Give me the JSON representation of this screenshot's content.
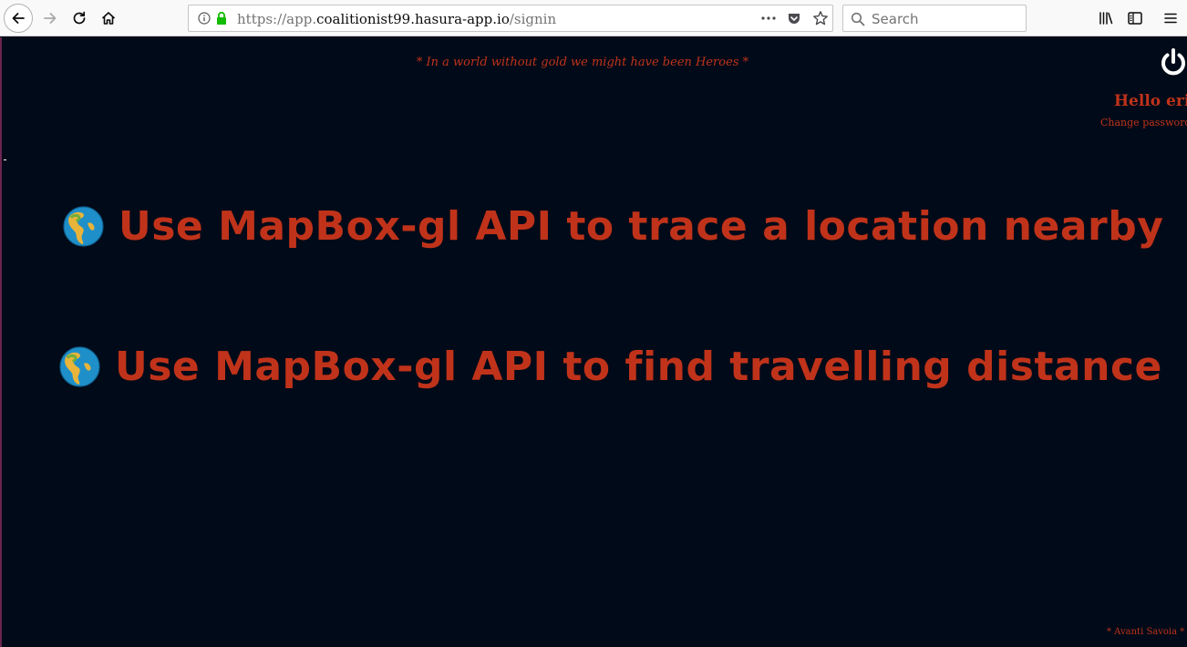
{
  "browser": {
    "url_scheme": "https://app.",
    "url_host": "coalitionist99.hasura-app.io",
    "url_path": "/signin",
    "search_placeholder": "Search",
    "icons": [
      "back-icon",
      "forward-icon",
      "reload-icon",
      "home-icon",
      "info-icon",
      "lock-icon",
      "more-icon",
      "pocket-icon",
      "star-icon",
      "search-icon",
      "library-icon",
      "sidebar-icon",
      "menu-icon"
    ]
  },
  "header": {
    "tagline": "* In a world without gold we might have been Heroes *",
    "greeting": "Hello erik",
    "change_password": "Change password?"
  },
  "features": [
    {
      "icon": "globe-americas-icon",
      "label": "Use MapBox-gl API to trace a location nearby"
    },
    {
      "icon": "globe-americas-icon",
      "label": "Use MapBox-gl API to find travelling distance"
    }
  ],
  "footer": {
    "note": "* Avanti Savoia *"
  },
  "colors": {
    "background": "#010a18",
    "accent": "#c0331a",
    "toolbar": "#f9f9fa"
  }
}
